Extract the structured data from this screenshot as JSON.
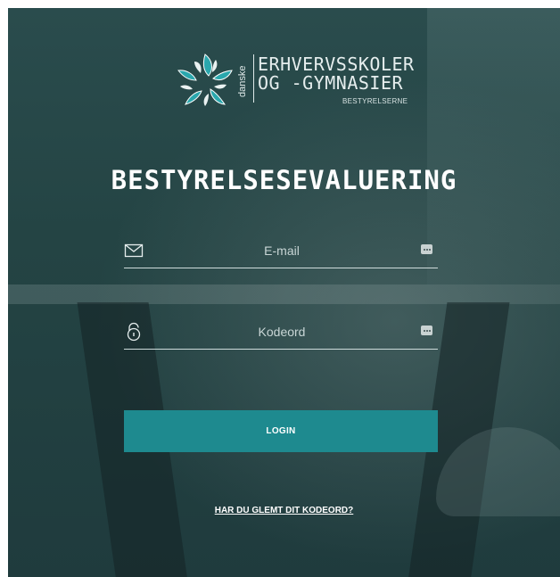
{
  "logo": {
    "danske": "danske",
    "line1": "ERHVERVSSKOLER",
    "line2": "OG -GYMNASIER",
    "line3": "BESTYRELSERNE",
    "mark_color": "#2aa7ad",
    "mark_icon": "star-burst-logo-icon"
  },
  "title": "BESTYRELSESEVALUERING",
  "email_field": {
    "placeholder": "E-mail",
    "value": "",
    "icon": "envelope-icon",
    "action_icon": "more-dots-icon"
  },
  "password_field": {
    "placeholder": "Kodeord",
    "value": "",
    "icon": "padlock-icon",
    "action_icon": "more-dots-icon"
  },
  "login_button": {
    "label": "LOGIN",
    "color": "#1e8a8f"
  },
  "forgot_link": "HAR DU GLEMT DIT KODEORD?",
  "colors": {
    "background": "#244444",
    "text": "#ffffff",
    "accent": "#1e8a8f"
  }
}
